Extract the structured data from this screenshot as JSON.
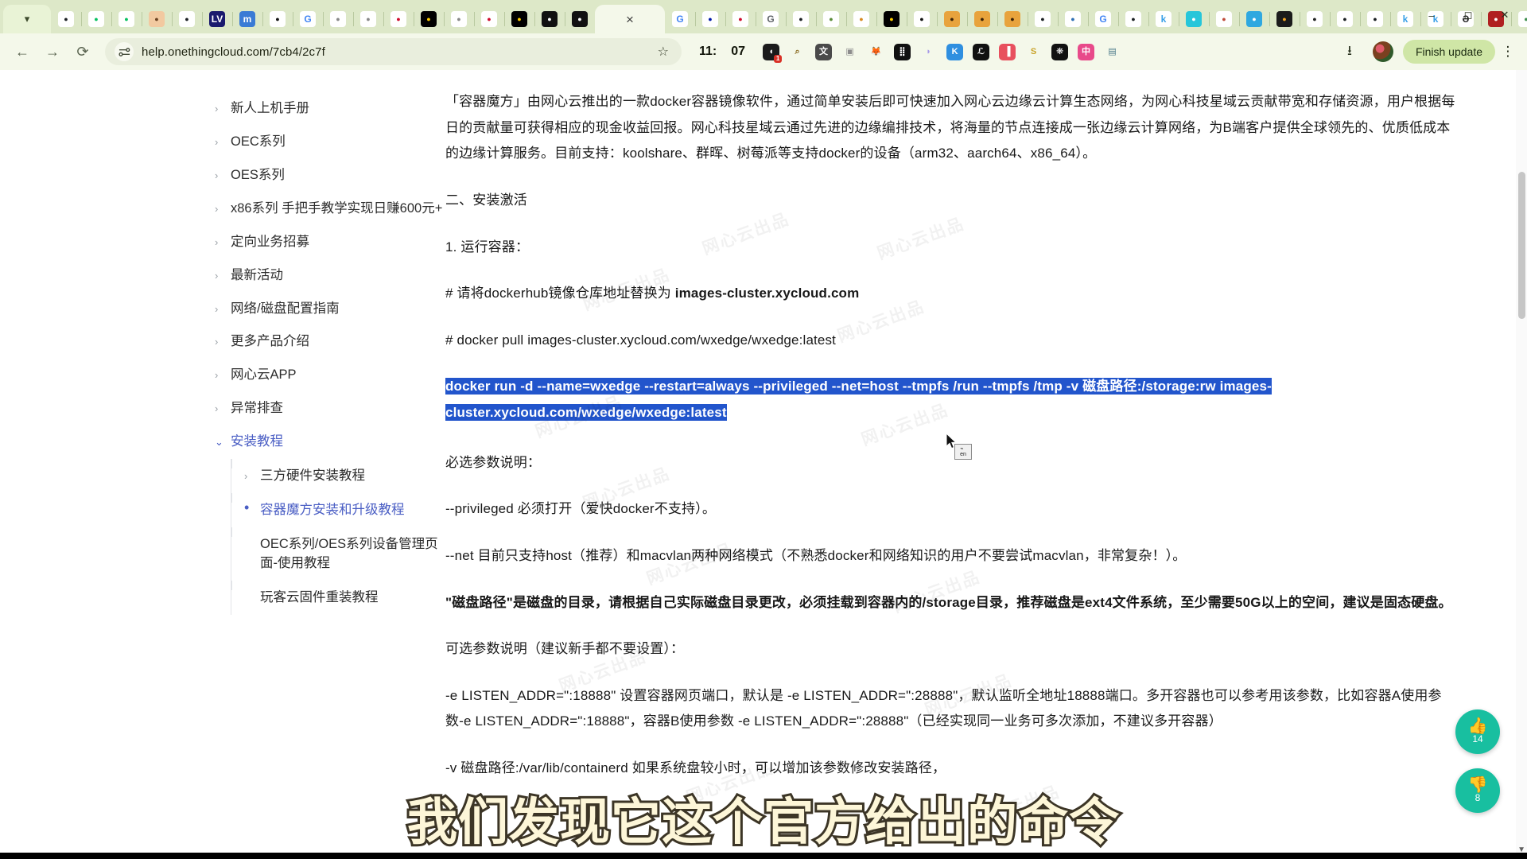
{
  "browser": {
    "window_controls": [
      "minimize",
      "maximize",
      "close"
    ],
    "new_tab_label": "+",
    "tab_overflow_icon": "chevron-down-icon",
    "active_tab_close": "×",
    "tabs": [
      {
        "icon": "github-icon",
        "glyph": "",
        "bg": "#ffffff",
        "fg": "#1b1f23"
      },
      {
        "icon": "wechat-icon",
        "glyph": "",
        "bg": "#ffffff",
        "fg": "#07c160"
      },
      {
        "icon": "wechat-icon",
        "glyph": "",
        "bg": "#ffffff",
        "fg": "#07c160"
      },
      {
        "icon": "avatar-icon",
        "glyph": "",
        "bg": "#f2c9a0",
        "fg": "#6b4322"
      },
      {
        "icon": "github-icon",
        "glyph": "",
        "bg": "#ffffff",
        "fg": "#1b1f23"
      },
      {
        "icon": "lv-logo-icon",
        "glyph": "LV",
        "bg": "#1a1a6e",
        "fg": "#ffffff"
      },
      {
        "icon": "mastodon-icon",
        "glyph": "m",
        "bg": "#3a7bd5",
        "fg": "#ffffff"
      },
      {
        "icon": "openai-icon",
        "glyph": "",
        "bg": "#ffffff",
        "fg": "#111111"
      },
      {
        "icon": "google-icon",
        "glyph": "G",
        "bg": "#ffffff",
        "fg": "#4285f4"
      },
      {
        "icon": "zhihu-icon",
        "glyph": "",
        "bg": "#ffffff",
        "fg": "#888888"
      },
      {
        "icon": "zhihu-icon",
        "glyph": "",
        "bg": "#ffffff",
        "fg": "#888888"
      },
      {
        "icon": "huawei-icon",
        "glyph": "",
        "bg": "#ffffff",
        "fg": "#cf0a2c"
      },
      {
        "icon": "germany-flag-icon",
        "glyph": "",
        "bg": "#000000",
        "fg": "#ffce00"
      },
      {
        "icon": "zhihu-icon",
        "glyph": "",
        "bg": "#ffffff",
        "fg": "#888888"
      },
      {
        "icon": "huawei-icon",
        "glyph": "",
        "bg": "#ffffff",
        "fg": "#cf0a2c"
      },
      {
        "icon": "germany-flag-icon",
        "glyph": "",
        "bg": "#000000",
        "fg": "#ffce00"
      },
      {
        "icon": "onething-cloud-icon",
        "glyph": "",
        "bg": "#111111",
        "fg": "#ffffff"
      },
      {
        "icon": "onething-cloud-icon",
        "glyph": "",
        "bg": "#111111",
        "fg": "#ffffff"
      },
      {
        "icon": "active-tab",
        "glyph": "",
        "bg": "",
        "fg": "",
        "active": true
      },
      {
        "icon": "google-icon",
        "glyph": "G",
        "bg": "#ffffff",
        "fg": "#4285f4"
      },
      {
        "icon": "deutsche-bank-icon",
        "glyph": "",
        "bg": "#ffffff",
        "fg": "#0018a8"
      },
      {
        "icon": "huawei-icon",
        "glyph": "",
        "bg": "#ffffff",
        "fg": "#cf0a2c"
      },
      {
        "icon": "google-icon",
        "glyph": "G",
        "bg": "#ffffff",
        "fg": "#5f6368"
      },
      {
        "icon": "github-icon",
        "glyph": "",
        "bg": "#ffffff",
        "fg": "#1b1f23"
      },
      {
        "icon": "loading-icon",
        "glyph": "",
        "bg": "#ffffff",
        "fg": "#5b8c3a"
      },
      {
        "icon": "loading-icon",
        "glyph": "",
        "bg": "#ffffff",
        "fg": "#d88a22"
      },
      {
        "icon": "germany-flag-icon",
        "glyph": "",
        "bg": "#000000",
        "fg": "#ffce00"
      },
      {
        "icon": "openai-icon",
        "glyph": "",
        "bg": "#ffffff",
        "fg": "#111111"
      },
      {
        "icon": "qr-code-icon",
        "glyph": "",
        "bg": "#e8a33d",
        "fg": "#3a2208"
      },
      {
        "icon": "qr-code-icon",
        "glyph": "",
        "bg": "#e8a33d",
        "fg": "#3a2208"
      },
      {
        "icon": "qr-code-icon",
        "glyph": "",
        "bg": "#e8a33d",
        "fg": "#3a2208"
      },
      {
        "icon": "github-loading-icon",
        "glyph": "",
        "bg": "#ffffff",
        "fg": "#1b1f23"
      },
      {
        "icon": "earth-icon",
        "glyph": "",
        "bg": "#ffffff",
        "fg": "#2f6fb5"
      },
      {
        "icon": "google-icon",
        "glyph": "G",
        "bg": "#ffffff",
        "fg": "#4285f4"
      },
      {
        "icon": "github-icon",
        "glyph": "",
        "bg": "#ffffff",
        "fg": "#1b1f23"
      },
      {
        "icon": "kimi-icon",
        "glyph": "k",
        "bg": "#ffffff",
        "fg": "#3aa0e8"
      },
      {
        "icon": "book-icon",
        "glyph": "",
        "bg": "#26c6da",
        "fg": "#ffffff"
      },
      {
        "icon": "broken-link-icon",
        "glyph": "",
        "bg": "#ffffff",
        "fg": "#c04a3a"
      },
      {
        "icon": "music-icon",
        "glyph": "",
        "bg": "#2fa8e0",
        "fg": "#ffffff"
      },
      {
        "icon": "rocket-icon",
        "glyph": "",
        "bg": "#1b1b1b",
        "fg": "#f5a623"
      },
      {
        "icon": "eye-icon",
        "glyph": "",
        "bg": "#ffffff",
        "fg": "#222222"
      },
      {
        "icon": "github-loading-icon",
        "glyph": "",
        "bg": "#ffffff",
        "fg": "#1b1f23"
      },
      {
        "icon": "github-icon",
        "glyph": "",
        "bg": "#ffffff",
        "fg": "#1b1f23"
      },
      {
        "icon": "kimi-icon",
        "glyph": "k",
        "bg": "#ffffff",
        "fg": "#3aa0e8"
      },
      {
        "icon": "kimi-icon",
        "glyph": "k",
        "bg": "#ffffff",
        "fg": "#3aa0e8"
      },
      {
        "icon": "exit-icon",
        "glyph": "Ə",
        "bg": "#ffffff",
        "fg": "#222222"
      },
      {
        "icon": "keyboard-icon",
        "glyph": "",
        "bg": "#b02020",
        "fg": "#ffffff"
      },
      {
        "icon": "globe-icon",
        "glyph": "",
        "bg": "#ffffff",
        "fg": "#3f8f4f"
      }
    ],
    "toolbar": {
      "back_icon": "back-arrow-icon",
      "forward_icon": "forward-arrow-icon",
      "reload_icon": "reload-icon",
      "site_settings_icon": "tune-icon",
      "url": "help.onethingcloud.com/7cb4/2c7f",
      "bookmark_icon": "star-icon",
      "clock_hours": "11:",
      "clock_minutes": "07",
      "download_icon": "download-icon",
      "profile_icon": "profile-avatar",
      "update_button": "Finish update",
      "menu_icon": "kebab-menu-icon"
    },
    "extensions": [
      {
        "name": "dark-reader-extension",
        "glyph": "◖",
        "bg": "#1b1b1b",
        "fg": "#ffffff",
        "badge": "1"
      },
      {
        "name": "magnifier-extension",
        "glyph": "⌕",
        "bg": "#f4f8ea",
        "fg": "#8a6a1f",
        "badge": ""
      },
      {
        "name": "translate-extension",
        "glyph": "文",
        "bg": "#4a4a4a",
        "fg": "#ffffff",
        "badge": ""
      },
      {
        "name": "screenshot-extension",
        "glyph": "▣",
        "bg": "#f4f8ea",
        "fg": "#8d8d8d",
        "badge": ""
      },
      {
        "name": "metamask-extension",
        "glyph": "🦊",
        "bg": "#f4f8ea",
        "fg": "#e2761b",
        "badge": ""
      },
      {
        "name": "grid-extension",
        "glyph": "⣿",
        "bg": "#111111",
        "fg": "#ffffff",
        "badge": ""
      },
      {
        "name": "ghost-extension",
        "glyph": "◗",
        "bg": "#f4f8ea",
        "fg": "#a79ae8",
        "badge": ""
      },
      {
        "name": "keepa-extension",
        "glyph": "K",
        "bg": "#2f8fe0",
        "fg": "#ffffff",
        "badge": ""
      },
      {
        "name": "script-extension",
        "glyph": "ℒ",
        "bg": "#111111",
        "fg": "#ffffff",
        "badge": ""
      },
      {
        "name": "pocket-extension",
        "glyph": "▐",
        "bg": "#e8505e",
        "fg": "#ffffff",
        "badge": ""
      },
      {
        "name": "sider-extension",
        "glyph": "S",
        "bg": "#f4f8ea",
        "fg": "#c9a227",
        "badge": ""
      },
      {
        "name": "snowflake-extension",
        "glyph": "❋",
        "bg": "#111111",
        "fg": "#ffffff",
        "badge": ""
      },
      {
        "name": "chinese-translate-extension",
        "glyph": "中",
        "bg": "#e84a8a",
        "fg": "#ffffff",
        "badge": ""
      },
      {
        "name": "seal-extension",
        "glyph": "▤",
        "bg": "#f4f8ea",
        "fg": "#4a7a8a",
        "badge": ""
      }
    ]
  },
  "sidebar": {
    "items": [
      {
        "label": "新人上机手册",
        "expanded": false
      },
      {
        "label": "OEC系列",
        "expanded": false
      },
      {
        "label": "OES系列",
        "expanded": false
      },
      {
        "label": "x86系列 手把手教学实现日赚600元+",
        "expanded": false
      },
      {
        "label": "定向业务招募",
        "expanded": false
      },
      {
        "label": "最新活动",
        "expanded": false
      },
      {
        "label": "网络/磁盘配置指南",
        "expanded": false
      },
      {
        "label": "更多产品介绍",
        "expanded": false
      },
      {
        "label": "网心云APP",
        "expanded": false
      },
      {
        "label": "异常排查",
        "expanded": false
      },
      {
        "label": "安装教程",
        "expanded": true
      }
    ],
    "subitems": [
      {
        "label": "三方硬件安装教程",
        "marker": "caret",
        "active": false
      },
      {
        "label": "容器魔方安装和升级教程",
        "marker": "dot",
        "active": true
      },
      {
        "label": "OEC系列/OES系列设备管理页面-使用教程",
        "marker": "none",
        "active": false
      },
      {
        "label": "玩客云固件重装教程",
        "marker": "none",
        "active": false
      }
    ]
  },
  "content": {
    "intro": "「容器魔方」由网心云推出的一款docker容器镜像软件，通过简单安装后即可快速加入网心云边缘云计算生态网络，为网心科技星域云贡献带宽和存储资源，用户根据每日的贡献量可获得相应的现金收益回报。网心科技星域云通过先进的边缘编排技术，将海量的节点连接成一张边缘云计算网络，为B端客户提供全球领先的、优质低成本的边缘计算服务。目前支持：koolshare、群晖、树莓派等支持docker的设备（arm32、aarch64、x86_64）。",
    "heading_install": "二、安装激活",
    "step1": "1. 运行容器：",
    "note_registry_prefix": "# 请将dockerhub镜像仓库地址替换为 ",
    "note_registry_bold": "images-cluster.xycloud.com",
    "docker_pull": "# docker pull  images-cluster.xycloud.com/wxedge/wxedge:latest",
    "docker_run_line1_a": "docker run -d --name=wxedge --restart=always --privileged --net=host --tmpfs /run --tmpfs /tmp -v ",
    "docker_run_line1_b": "磁盘路径",
    "docker_run_line1_c": ":/storage:rw",
    "docker_run_line2": "images-cluster.xycloud.com/wxedge/wxedge:latest",
    "required_params_title": "必选参数说明：",
    "privileged_note": "--privileged 必须打开（爱快docker不支持）。",
    "net_note": "--net 目前只支持host（推荐）和macvlan两种网络模式（不熟悉docker和网络知识的用户不要尝试macvlan，非常复杂！）。",
    "disk_note": "\"磁盘路径\"是磁盘的目录，请根据自己实际磁盘目录更改，必须挂载到容器内的/storage目录，推荐磁盘是ext4文件系统，至少需要50G以上的空间，建议是固态硬盘。",
    "optional_params_title": "可选参数说明（建议新手都不要设置）：",
    "listen_addr_note": "-e LISTEN_ADDR=\":18888\" 设置容器网页端口，默认是 -e LISTEN_ADDR=\":28888\"，默认监听全地址18888端口。多开容器也可以参考用该参数，比如容器A使用参数-e LISTEN_ADDR=\":18888\"，容器B使用参数 -e LISTEN_ADDR=\":28888\"（已经实现同一业务可多次添加，不建议多开容器）",
    "containerd_note": "-v 磁盘路径:/var/lib/containerd 如果系统盘较小时，可以增加该参数修改安装路径，",
    "watermark": "网心云出品"
  },
  "overlay": {
    "subtitle": "我们发现它这个官方给出的命令"
  },
  "feedback": {
    "like_icon": "thumbs-up-icon",
    "like_count": "14",
    "dislike_icon": "thumbs-down-icon",
    "dislike_count": "8"
  },
  "colors": {
    "chrome_tabstrip": "#dde8c8",
    "chrome_toolbar": "#f4f8ea",
    "selection_blue": "#2255cc",
    "link_blue": "#4a5ec4",
    "fab_teal": "#18bfa0",
    "update_button": "#cfe6a6"
  }
}
